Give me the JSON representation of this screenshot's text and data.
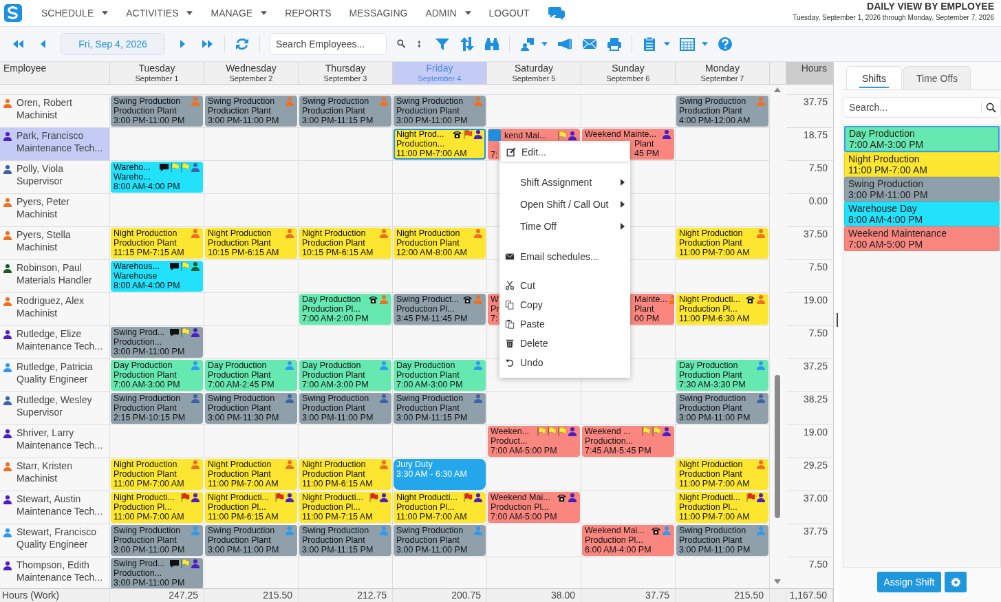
{
  "nav": {
    "items": [
      {
        "label": "SCHEDULE",
        "dropdown": true
      },
      {
        "label": "ACTIVITIES",
        "dropdown": true
      },
      {
        "label": "MANAGE",
        "dropdown": true
      },
      {
        "label": "REPORTS",
        "dropdown": false
      },
      {
        "label": "MESSAGING",
        "dropdown": false
      },
      {
        "label": "ADMIN",
        "dropdown": true
      },
      {
        "label": "LOGOUT",
        "dropdown": false
      }
    ],
    "title": "DAILY VIEW BY EMPLOYEE",
    "subtitle": "Tuesday, September 1, 2026 through Monday, September 7, 2026"
  },
  "toolbar": {
    "date": "Fri, Sep 4, 2026",
    "search_placeholder": "Search Employees..."
  },
  "grid": {
    "employee_header": "Employee",
    "hours_header": "Hours",
    "days": [
      {
        "name": "Tuesday",
        "date": "September 1",
        "selected": false
      },
      {
        "name": "Wednesday",
        "date": "September 2",
        "selected": false
      },
      {
        "name": "Thursday",
        "date": "September 3",
        "selected": false
      },
      {
        "name": "Friday",
        "date": "September 4",
        "selected": true
      },
      {
        "name": "Saturday",
        "date": "September 5",
        "selected": false
      },
      {
        "name": "Sunday",
        "date": "September 6",
        "selected": false
      },
      {
        "name": "Monday",
        "date": "September 7",
        "selected": false
      }
    ],
    "rows": [
      {
        "name": "Oren, Robert",
        "role": "Machinist",
        "color": "#f07022",
        "selected": false,
        "hours": "37.75",
        "cells": [
          {
            "kind": "swing",
            "lines": [
              "Swing Production",
              "Production Plant",
              "3:00 PM-11:00 PM"
            ],
            "person": true,
            "phone": false,
            "chat": false,
            "selected": false
          },
          {
            "kind": "swing",
            "lines": [
              "Swing Production",
              "Production Plant",
              "3:00 PM-11:00 PM"
            ],
            "person": true,
            "phone": false,
            "chat": false,
            "selected": false
          },
          {
            "kind": "swing",
            "lines": [
              "Swing Production",
              "Production Plant",
              "3:00 PM-11:15 PM"
            ],
            "person": true,
            "phone": false,
            "chat": false,
            "selected": false
          },
          {
            "kind": "swing",
            "lines": [
              "Swing Production",
              "Production Plant",
              "3:00 PM-11:00 PM"
            ],
            "person": true,
            "phone": false,
            "chat": false,
            "selected": false
          },
          null,
          null,
          {
            "kind": "swing",
            "lines": [
              "Swing Production",
              "Production Plant",
              "4:00 PM-12:00 AM"
            ],
            "person": true,
            "phone": false,
            "chat": false,
            "selected": false
          }
        ]
      },
      {
        "name": "Park, Francisco",
        "role": "Maintenance Tech...",
        "color": "#4a1fc4",
        "selected": true,
        "hours": "18.75",
        "cells": [
          null,
          null,
          null,
          {
            "kind": "night",
            "lines": [
              "Night Prod...",
              "Production...",
              "11:00 PM-7:00 AM"
            ],
            "person": true,
            "phone": true,
            "chat": false,
            "flags": [
              {
                "color": "#f0501e"
              }
            ],
            "selected": true
          },
          {
            "kind": "weekend",
            "lines": [
              "kend Mai...",
              "7:"
            ],
            "person": true,
            "phone": false,
            "chat": false,
            "flags": [
              {
                "color": "#f8ec3a"
              }
            ],
            "selected": false,
            "handle": true,
            "gap_middle": true
          },
          {
            "kind": "weekend",
            "lines": [
              "Weekend Mainte...",
              "Plant",
              "45 PM"
            ],
            "person": true,
            "phone": false,
            "chat": false,
            "selected": false,
            "offset_body": true
          },
          null
        ]
      },
      {
        "name": "Polly, Viola",
        "role": "Supervisor",
        "color": "#3f63a8",
        "selected": false,
        "hours": "7.50",
        "cells": [
          {
            "kind": "warehouse",
            "lines": [
              "Wareho...",
              "Wareho...",
              "8:00 AM-4:00 PM"
            ],
            "person": true,
            "phone": false,
            "chat": true,
            "flags": [
              {
                "color": "#f8ec3a"
              },
              {
                "color": "#f8ec3a"
              }
            ],
            "selected": false
          },
          null,
          null,
          null,
          null,
          null,
          null
        ]
      },
      {
        "name": "Pyers, Peter",
        "role": "Machinist",
        "color": "#f07022",
        "selected": false,
        "hours": "0.00",
        "cells": [
          null,
          null,
          null,
          null,
          null,
          null,
          null
        ]
      },
      {
        "name": "Pyers, Stella",
        "role": "Machinist",
        "color": "#f07022",
        "selected": false,
        "hours": "37.50",
        "cells": [
          {
            "kind": "night",
            "lines": [
              "Night Production",
              "Production Plant",
              "11:15 PM-7:15 AM"
            ],
            "person": true,
            "phone": false,
            "chat": false,
            "selected": false
          },
          {
            "kind": "night",
            "lines": [
              "Night Production",
              "Production Plant",
              "10:15 PM-6:15 AM"
            ],
            "person": true,
            "phone": false,
            "chat": false,
            "selected": false
          },
          {
            "kind": "night",
            "lines": [
              "Night Production",
              "Production Plant",
              "10:15 PM-6:15 AM"
            ],
            "person": true,
            "phone": false,
            "chat": false,
            "selected": false
          },
          {
            "kind": "night",
            "lines": [
              "Night Production",
              "Production Plant",
              "12:00 AM-8:00 AM"
            ],
            "person": true,
            "phone": false,
            "chat": false,
            "selected": false
          },
          null,
          null,
          {
            "kind": "night",
            "lines": [
              "Night Production",
              "Production Plant",
              "11:00 PM-7:00 AM"
            ],
            "person": true,
            "phone": false,
            "chat": false,
            "selected": false
          }
        ]
      },
      {
        "name": "Robinson, Paul",
        "role": "Materials Handler",
        "color": "#1d5a2c",
        "selected": false,
        "hours": "7.50",
        "cells": [
          {
            "kind": "warehouse",
            "lines": [
              "Warehous...",
              "Warehouse",
              "8:00 AM-4:00 PM"
            ],
            "person": true,
            "phone": false,
            "chat": true,
            "flags": [
              {
                "color": "#f8ec3a"
              }
            ],
            "selected": false
          },
          null,
          null,
          null,
          null,
          null,
          null
        ]
      },
      {
        "name": "Rodriguez, Alex",
        "role": "Machinist",
        "color": "#f07022",
        "selected": false,
        "hours": "19.00",
        "cells": [
          null,
          null,
          {
            "kind": "day",
            "lines": [
              "Day Production",
              "Production Pl...",
              "7:00 AM-2:00 PM"
            ],
            "person": true,
            "phone": true,
            "chat": false,
            "selected": false
          },
          {
            "kind": "swing",
            "lines": [
              "Swing Product...",
              "Production Pl...",
              "3:45 PM-11:45 PM"
            ],
            "person": true,
            "phone": true,
            "chat": false,
            "selected": false
          },
          {
            "kind": "weekend",
            "lines": [
              "W",
              "Pr",
              "7:"
            ],
            "person": false,
            "phone": false,
            "chat": false,
            "selected": false
          },
          {
            "kind": "weekend",
            "lines": [
              "Mainte...",
              "Plant",
              "00 PM"
            ],
            "person": true,
            "phone": false,
            "chat": false,
            "selected": false,
            "offset_title": true,
            "offset_body": true
          },
          {
            "kind": "night",
            "lines": [
              "Night Producti...",
              "Production Pl...",
              "11:00 PM-6:30 AM"
            ],
            "person": true,
            "phone": true,
            "chat": false,
            "selected": false
          }
        ]
      },
      {
        "name": "Rutledge, Elize",
        "role": "Maintenance Tech...",
        "color": "#4a1fc4",
        "selected": false,
        "hours": "7.50",
        "cells": [
          {
            "kind": "swing",
            "lines": [
              "Swing Prod...",
              "Production...",
              "3:00 PM-11:00 PM"
            ],
            "person": true,
            "phone": false,
            "chat": true,
            "flags": [
              {
                "color": "#f8ec3a"
              }
            ],
            "selected": false
          },
          null,
          null,
          null,
          null,
          null,
          null
        ]
      },
      {
        "name": "Rutledge, Patricia",
        "role": "Quality Engineer",
        "color": "#2f9bef",
        "selected": false,
        "hours": "37.25",
        "cells": [
          {
            "kind": "day",
            "lines": [
              "Day Production",
              "Production Plant",
              "7:00 AM-3:00 PM"
            ],
            "person": true,
            "phone": false,
            "chat": false,
            "selected": false
          },
          {
            "kind": "day",
            "lines": [
              "Day Production",
              "Production Plant",
              "7:00 AM-2:45 PM"
            ],
            "person": true,
            "phone": false,
            "chat": false,
            "selected": false
          },
          {
            "kind": "day",
            "lines": [
              "Day Production",
              "Production Plant",
              "7:00 AM-3:00 PM"
            ],
            "person": true,
            "phone": false,
            "chat": false,
            "selected": false
          },
          {
            "kind": "day",
            "lines": [
              "Day Production",
              "Production Plant",
              "7:00 AM-3:00 PM"
            ],
            "person": true,
            "phone": false,
            "chat": false,
            "selected": false
          },
          null,
          null,
          {
            "kind": "day",
            "lines": [
              "Day Production",
              "Production Plant",
              "7:30 AM-3:30 PM"
            ],
            "person": true,
            "phone": false,
            "chat": false,
            "selected": false
          }
        ]
      },
      {
        "name": "Rutledge, Wesley",
        "role": "Supervisor",
        "color": "#3f63a8",
        "selected": false,
        "hours": "38.25",
        "cells": [
          {
            "kind": "swing",
            "lines": [
              "Swing Production",
              "Production Plant",
              "2:15 PM-10:15 PM"
            ],
            "person": true,
            "phone": false,
            "chat": false,
            "selected": false
          },
          {
            "kind": "swing",
            "lines": [
              "Swing Production",
              "Production Plant",
              "3:00 PM-11:30 PM"
            ],
            "person": true,
            "phone": false,
            "chat": false,
            "selected": false
          },
          {
            "kind": "swing",
            "lines": [
              "Swing Production",
              "Production Plant",
              "3:00 PM-11:00 PM"
            ],
            "person": true,
            "phone": false,
            "chat": false,
            "selected": false
          },
          {
            "kind": "swing",
            "lines": [
              "Swing Production",
              "Production Plant",
              "3:00 PM-11:15 PM"
            ],
            "person": true,
            "phone": false,
            "chat": false,
            "selected": false
          },
          null,
          null,
          {
            "kind": "swing",
            "lines": [
              "Swing Production",
              "Production Plant",
              "3:00 PM-11:00 PM"
            ],
            "person": true,
            "phone": false,
            "chat": false,
            "selected": false
          }
        ]
      },
      {
        "name": "Shriver, Larry",
        "role": "Maintenance Tech...",
        "color": "#4a1fc4",
        "selected": false,
        "hours": "19.00",
        "cells": [
          null,
          null,
          null,
          null,
          {
            "kind": "weekend",
            "lines": [
              "Weeken...",
              "Product...",
              "7:00 AM-5:00 PM"
            ],
            "person": true,
            "phone": false,
            "chat": false,
            "flags": [
              {
                "color": "#f8ec3a"
              },
              {
                "color": "#f8ec3a"
              },
              {
                "color": "#f8ec3a"
              }
            ],
            "selected": false
          },
          {
            "kind": "weekend",
            "lines": [
              "Weekend ...",
              "Production...",
              "7:45 AM-5:45 PM"
            ],
            "person": true,
            "phone": false,
            "chat": false,
            "flags": [
              {
                "color": "#f8ec3a"
              },
              {
                "color": "#f8ec3a"
              }
            ],
            "selected": false
          },
          null
        ]
      },
      {
        "name": "Starr, Kristen",
        "role": "Machinist",
        "color": "#f07022",
        "selected": false,
        "hours": "29.25",
        "cells": [
          {
            "kind": "night",
            "lines": [
              "Night Production",
              "Production Plant",
              "11:00 PM-7:00 AM"
            ],
            "person": true,
            "phone": false,
            "chat": false,
            "selected": false
          },
          {
            "kind": "night",
            "lines": [
              "Night Production",
              "Production Plant",
              "11:00 PM-7:00 AM"
            ],
            "person": true,
            "phone": false,
            "chat": false,
            "selected": false
          },
          {
            "kind": "night",
            "lines": [
              "Night Production",
              "Production Plant",
              "11:00 PM-6:15 AM"
            ],
            "person": true,
            "phone": false,
            "chat": false,
            "selected": false
          },
          {
            "kind": "jury",
            "lines": [
              "Jury Duty",
              "3:30 AM - 6:30 AM"
            ],
            "person": false,
            "phone": false,
            "chat": false,
            "selected": false
          },
          null,
          null,
          {
            "kind": "night",
            "lines": [
              "Night Production",
              "Production Plant",
              "11:00 PM-7:00 AM"
            ],
            "person": true,
            "phone": false,
            "chat": false,
            "selected": false
          }
        ]
      },
      {
        "name": "Stewart, Austin",
        "role": "Maintenance Tech...",
        "color": "#4a1fc4",
        "selected": false,
        "hours": "37.00",
        "cells": [
          {
            "kind": "night",
            "lines": [
              "Night Producti...",
              "Production Pl...",
              "11:00 PM-7:00 AM"
            ],
            "person": true,
            "phone": false,
            "chat": false,
            "flags": [
              {
                "color": "#e8261d"
              }
            ],
            "selected": false
          },
          {
            "kind": "night",
            "lines": [
              "Night Producti...",
              "Production Pl...",
              "11:00 PM-6:15 AM"
            ],
            "person": true,
            "phone": false,
            "chat": false,
            "flags": [
              {
                "color": "#e8261d"
              }
            ],
            "selected": false
          },
          {
            "kind": "night",
            "lines": [
              "Night Producti...",
              "Production Pl...",
              "11:00 PM-7:15 AM"
            ],
            "person": true,
            "phone": false,
            "chat": false,
            "flags": [
              {
                "color": "#e8261d"
              }
            ],
            "selected": false
          },
          {
            "kind": "night",
            "lines": [
              "Night Producti...",
              "Production Pl...",
              "11:00 PM-7:00 AM"
            ],
            "person": true,
            "phone": false,
            "chat": false,
            "flags": [
              {
                "color": "#e8261d"
              }
            ],
            "selected": false
          },
          {
            "kind": "weekend",
            "lines": [
              "Weekend Mai...",
              "Production Pl...",
              "7:00 AM-5:00 PM"
            ],
            "person": true,
            "phone": true,
            "chat": false,
            "selected": false
          },
          null,
          {
            "kind": "night",
            "lines": [
              "Night Producti...",
              "Production Pl...",
              "11:00 PM-7:00 AM"
            ],
            "person": true,
            "phone": false,
            "chat": false,
            "flags": [
              {
                "color": "#e8261d"
              }
            ],
            "selected": false
          }
        ]
      },
      {
        "name": "Stewart, Francisco",
        "role": "Quality Engineer",
        "color": "#2f9bef",
        "selected": false,
        "hours": "37.75",
        "cells": [
          {
            "kind": "swing",
            "lines": [
              "Swing Production",
              "Production Plant",
              "3:00 PM-11:00 PM"
            ],
            "person": true,
            "phone": false,
            "chat": false,
            "selected": false
          },
          {
            "kind": "swing",
            "lines": [
              "Swing Production",
              "Production Plant",
              "3:00 PM-11:00 PM"
            ],
            "person": true,
            "phone": false,
            "chat": false,
            "selected": false
          },
          {
            "kind": "swing",
            "lines": [
              "Swing Production",
              "Production Plant",
              "3:00 PM-11:15 PM"
            ],
            "person": true,
            "phone": false,
            "chat": false,
            "selected": false
          },
          {
            "kind": "swing",
            "lines": [
              "Swing Production",
              "Production Plant",
              "3:00 PM-11:00 PM"
            ],
            "person": true,
            "phone": false,
            "chat": false,
            "selected": false
          },
          null,
          {
            "kind": "weekend",
            "lines": [
              "Weekend Mai...",
              "Production Pl...",
              "6:00 AM-4:00 PM"
            ],
            "person": true,
            "phone": true,
            "chat": false,
            "selected": false
          },
          {
            "kind": "swing",
            "lines": [
              "Swing Production",
              "Production Plant",
              "3:00 PM-11:00 PM"
            ],
            "person": true,
            "phone": false,
            "chat": false,
            "selected": false
          }
        ]
      },
      {
        "name": "Thompson, Edith",
        "role": "Maintenance Tech...",
        "color": "#4a1fc4",
        "selected": false,
        "hours": "7.50",
        "cells": [
          {
            "kind": "swing",
            "lines": [
              "Swing Prod...",
              "Production...",
              "3:00 PM-11:00 PM"
            ],
            "person": true,
            "phone": false,
            "chat": true,
            "flags": [
              {
                "color": "#f8ec3a"
              }
            ],
            "selected": false
          },
          null,
          null,
          null,
          null,
          null,
          null
        ]
      }
    ],
    "footer": {
      "label": "Hours (Work)",
      "totals": [
        "247.25",
        "215.50",
        "212.75",
        "200.75",
        "38.00",
        "37.75",
        "215.50"
      ],
      "grand_total": "1,167.50"
    }
  },
  "context_menu": [
    [
      {
        "kind": "edit",
        "label": "Edit...",
        "highlighted": true,
        "submenu": false
      }
    ],
    [
      {
        "kind": "none",
        "label": "Shift Assignment",
        "highlighted": false,
        "submenu": true
      },
      {
        "kind": "none",
        "label": "Open Shift / Call Out",
        "highlighted": false,
        "submenu": true
      },
      {
        "kind": "none",
        "label": "Time Off",
        "highlighted": false,
        "submenu": true
      }
    ],
    [
      {
        "kind": "mail",
        "label": "Email schedules...",
        "highlighted": false,
        "submenu": false
      }
    ],
    [
      {
        "kind": "cut",
        "label": "Cut",
        "highlighted": false,
        "submenu": false
      },
      {
        "kind": "copy",
        "label": "Copy",
        "highlighted": false,
        "submenu": false
      },
      {
        "kind": "paste",
        "label": "Paste",
        "highlighted": false,
        "submenu": false
      },
      {
        "kind": "delete",
        "label": "Delete",
        "highlighted": false,
        "submenu": false
      },
      {
        "kind": "undo",
        "label": "Undo",
        "highlighted": false,
        "submenu": false
      }
    ]
  ],
  "panel": {
    "tabs": [
      {
        "label": "Shifts",
        "selected": true
      },
      {
        "label": "Time Offs",
        "selected": false
      }
    ],
    "search_placeholder": "Search...",
    "shifts": [
      {
        "kind": "day",
        "name": "Day Production",
        "time": "7:00 AM-3:00 PM",
        "selected": true
      },
      {
        "kind": "night",
        "name": "Night Production",
        "time": "11:00 PM-7:00 AM",
        "selected": false
      },
      {
        "kind": "swing",
        "name": "Swing Production",
        "time": "3:00 PM-11:00 PM",
        "selected": false
      },
      {
        "kind": "warehouse",
        "name": "Warehouse Day",
        "time": "8:00 AM-4:00 PM",
        "selected": false
      },
      {
        "kind": "weekend",
        "name": "Weekend Maintenance",
        "time": "7:00 AM-5:00 PM",
        "selected": false
      }
    ],
    "assign_button": "Assign Shift"
  }
}
